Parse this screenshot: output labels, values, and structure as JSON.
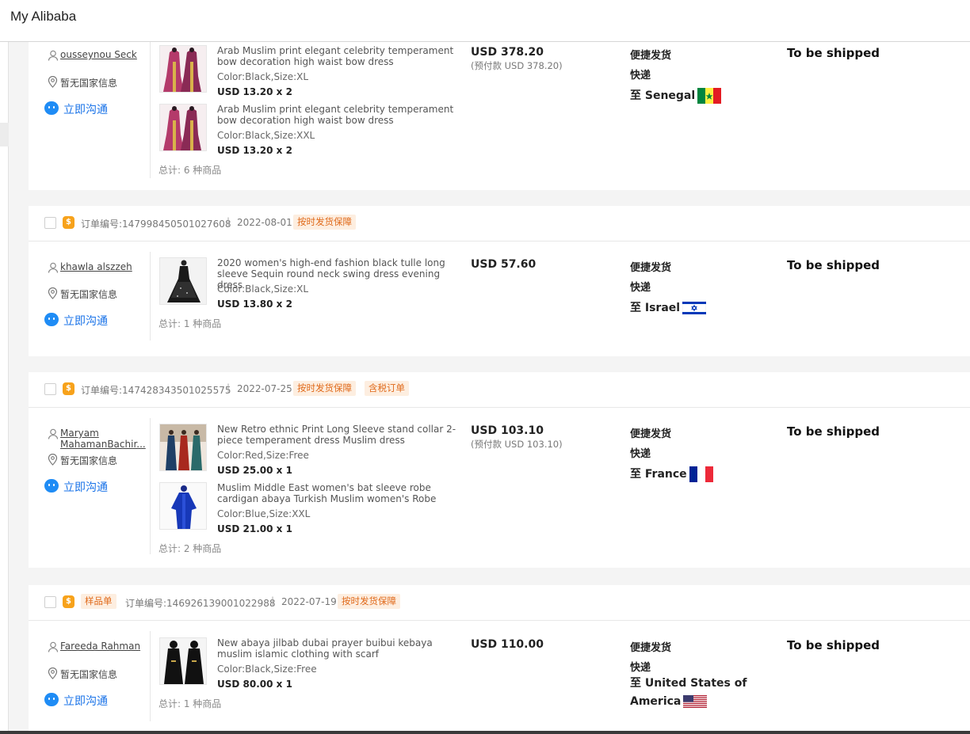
{
  "app": {
    "title": "My Alibaba"
  },
  "common": {
    "chat_label": "立即沟通",
    "no_country": "暂无国家信息",
    "ship_method": "便捷发货",
    "courier": "快递",
    "status": "To be shipped"
  },
  "orders": [
    {
      "buyer": "ousseynou Seck",
      "price": "USD 378.20",
      "deposit": "(预付款 USD 378.20)",
      "destination": "至 Senegal",
      "total": "总计: 6 种商品",
      "items": [
        {
          "title": "Arab Muslim print elegant celebrity temperament bow decoration high waist bow dress",
          "spec": "Color:Black,Size:XL",
          "qty": "USD 13.20 x 2"
        },
        {
          "title": "Arab Muslim print elegant celebrity temperament bow decoration high waist bow dress",
          "spec": "Color:Black,Size:XXL",
          "qty": "USD 13.20 x 2"
        }
      ]
    },
    {
      "order_no": "订单编号:147998450501027608",
      "sep": "|",
      "date": "2022-08-01",
      "tags": [
        "按时发货保障"
      ],
      "buyer": "khawla alszzeh",
      "price": "USD 57.60",
      "destination": "至 Israel",
      "total": "总计: 1 种商品",
      "items": [
        {
          "title": "2020 women's high-end fashion black tulle long sleeve Sequin round neck swing dress evening dress",
          "spec": "Color:Black,Size:XL",
          "qty": "USD 13.80 x 2"
        }
      ]
    },
    {
      "order_no": "订单编号:147428343501025575",
      "sep": "|",
      "date": "2022-07-25",
      "tags": [
        "按时发货保障",
        "含税订单"
      ],
      "buyer": "Maryam MahamanBachir...",
      "price": "USD 103.10",
      "deposit": "(预付款 USD 103.10)",
      "destination": "至 France",
      "total": "总计: 2 种商品",
      "items": [
        {
          "title": "New Retro ethnic Print Long Sleeve stand collar 2-piece temperament dress Muslim dress",
          "spec": "Color:Red,Size:Free",
          "qty": "USD 25.00 x 1"
        },
        {
          "title": "Muslim Middle East women's bat sleeve robe cardigan abaya Turkish Muslim women's Robe",
          "spec": "Color:Blue,Size:XXL",
          "qty": "USD 21.00 x 1"
        }
      ]
    },
    {
      "sample_tag": "样品单",
      "order_no": "订单编号:146926139001022988",
      "sep": "|",
      "date": "2022-07-19",
      "tags": [
        "按时发货保障"
      ],
      "buyer": "Fareeda Rahman",
      "price": "USD 110.00",
      "destination": "至 United States of America",
      "total": "总计: 1 种商品",
      "items": [
        {
          "title": "New abaya jilbab dubai prayer buibui kebaya muslim islamic clothing with scarf",
          "spec": "Color:Black,Size:Free",
          "qty": "USD 80.00 x 1"
        }
      ]
    }
  ],
  "colors": {
    "link_blue": "#1a73e8",
    "tag_orange": "#e06a1b",
    "tag_bg": "#fdeee0",
    "coin": "#f7a21b"
  }
}
